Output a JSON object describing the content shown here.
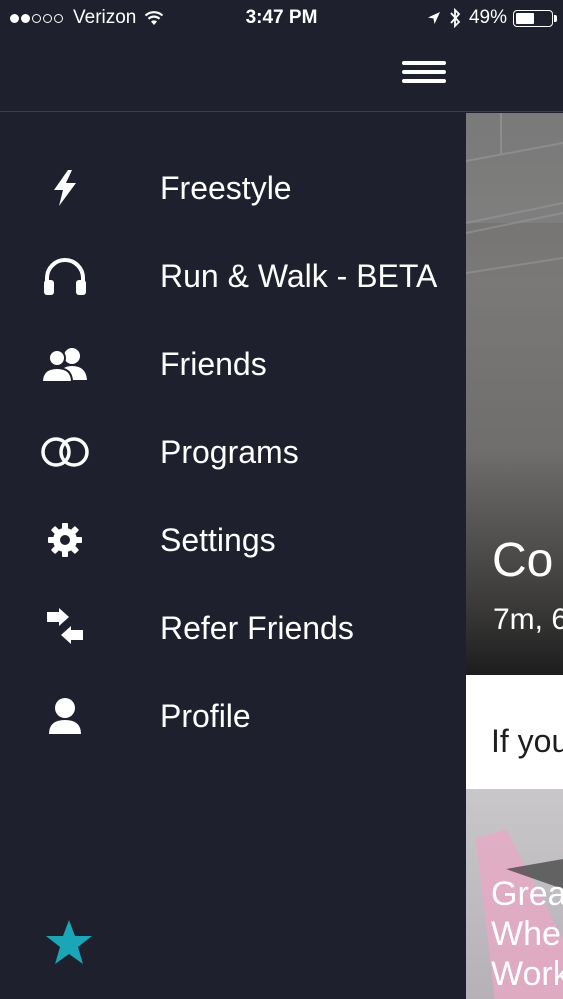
{
  "status_bar": {
    "carrier": "Verizon",
    "time": "3:47 PM",
    "battery": "49%",
    "signal_dots_filled": 2,
    "signal_dots_total": 5
  },
  "nav": {
    "menu_icon": "hamburger-icon"
  },
  "menu": {
    "items": [
      {
        "label": "Freestyle",
        "icon": "lightning-icon"
      },
      {
        "label": "Run & Walk - BETA",
        "icon": "headphones-icon"
      },
      {
        "label": "Friends",
        "icon": "friends-icon"
      },
      {
        "label": "Programs",
        "icon": "programs-icon"
      },
      {
        "label": "Settings",
        "icon": "gear-icon"
      },
      {
        "label": "Refer Friends",
        "icon": "refer-arrows-icon"
      },
      {
        "label": "Profile",
        "icon": "profile-icon"
      }
    ]
  },
  "footer": {
    "icon": "star-icon",
    "accent": "#1aa6b7"
  },
  "content": {
    "hero_title": "Co",
    "hero_subtitle": "7m, 6",
    "card_text": "If you",
    "card2_lines": [
      "Grea",
      "Whe",
      "Work"
    ]
  },
  "colors": {
    "background": "#1e212d",
    "text": "#ffffff",
    "accent": "#1aa6b7"
  }
}
